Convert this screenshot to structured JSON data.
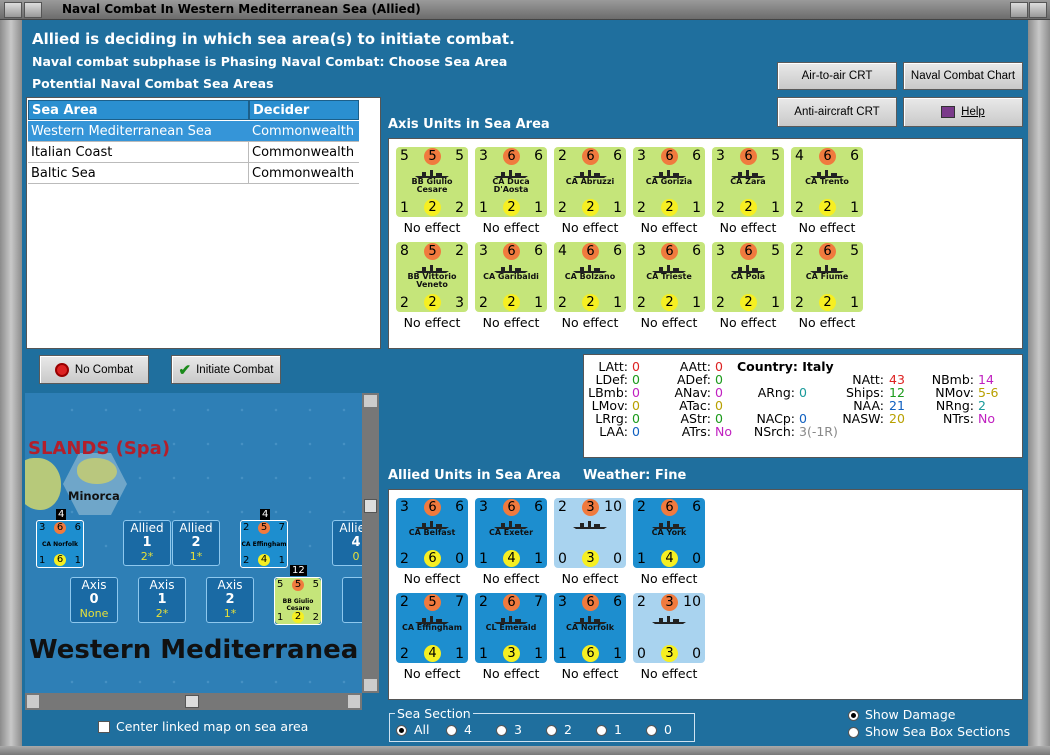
{
  "window": {
    "title": "Naval Combat In Western Mediterranean Sea (Allied)"
  },
  "header": {
    "line1": "Allied is deciding in which sea area(s) to initiate combat.",
    "line2": "Naval combat subphase is Phasing Naval Combat: Choose Sea Area",
    "line3": "Potential Naval Combat Sea Areas"
  },
  "buttons": {
    "air_to_air": "Air-to-air CRT",
    "naval_chart": "Naval Combat Chart",
    "anti_aircraft": "Anti-aircraft CRT",
    "help": "Help",
    "no_combat": "No Combat",
    "initiate": "Initiate Combat"
  },
  "table": {
    "headers": [
      "Sea Area",
      "Decider"
    ],
    "rows": [
      {
        "area": "Western Mediterranean Sea",
        "decider": "Commonwealth"
      },
      {
        "area": "Italian Coast",
        "decider": "Commonwealth"
      },
      {
        "area": "Baltic Sea",
        "decider": "Commonwealth"
      }
    ]
  },
  "axis": {
    "label": "Axis Units in Sea Area",
    "units": [
      {
        "tl": "5",
        "tm": "5",
        "tr": "5",
        "name": "BB Giulio Cesare",
        "bl": "1",
        "bm": "2",
        "br": "2",
        "effect": "No effect"
      },
      {
        "tl": "3",
        "tm": "6",
        "tr": "6",
        "name": "CA Duca D'Aosta",
        "bl": "1",
        "bm": "2",
        "br": "1",
        "effect": "No effect"
      },
      {
        "tl": "2",
        "tm": "6",
        "tr": "6",
        "name": "CA Abruzzi",
        "bl": "2",
        "bm": "2",
        "br": "1",
        "effect": "No effect"
      },
      {
        "tl": "3",
        "tm": "6",
        "tr": "6",
        "name": "CA Gorizia",
        "bl": "2",
        "bm": "2",
        "br": "1",
        "effect": "No effect"
      },
      {
        "tl": "3",
        "tm": "6",
        "tr": "5",
        "name": "CA Zara",
        "bl": "2",
        "bm": "2",
        "br": "1",
        "effect": "No effect"
      },
      {
        "tl": "4",
        "tm": "6",
        "tr": "6",
        "name": "CA Trento",
        "bl": "2",
        "bm": "2",
        "br": "1",
        "effect": "No effect"
      },
      {
        "tl": "8",
        "tm": "5",
        "tr": "2",
        "name": "BB Vittorio Veneto",
        "bl": "2",
        "bm": "2",
        "br": "3",
        "effect": "No effect"
      },
      {
        "tl": "3",
        "tm": "6",
        "tr": "6",
        "name": "CA Garibaldi",
        "bl": "2",
        "bm": "2",
        "br": "1",
        "effect": "No effect"
      },
      {
        "tl": "4",
        "tm": "6",
        "tr": "6",
        "name": "CA Bolzano",
        "bl": "2",
        "bm": "2",
        "br": "1",
        "effect": "No effect"
      },
      {
        "tl": "3",
        "tm": "6",
        "tr": "6",
        "name": "CA Trieste",
        "bl": "2",
        "bm": "2",
        "br": "1",
        "effect": "No effect"
      },
      {
        "tl": "3",
        "tm": "6",
        "tr": "5",
        "name": "CA Pola",
        "bl": "2",
        "bm": "2",
        "br": "1",
        "effect": "No effect"
      },
      {
        "tl": "2",
        "tm": "6",
        "tr": "5",
        "name": "CA Fiume",
        "bl": "2",
        "bm": "2",
        "br": "1",
        "effect": "No effect"
      }
    ]
  },
  "info": {
    "country_label": "Country: Italy",
    "col1": [
      [
        "LAtt:",
        "0"
      ],
      [
        "LDef:",
        "0"
      ],
      [
        "LBmb:",
        "0"
      ],
      [
        "LMov:",
        "0"
      ],
      [
        "LRrg:",
        "0"
      ],
      [
        "LAA:",
        "0"
      ]
    ],
    "col2": [
      [
        "AAtt:",
        "0"
      ],
      [
        "ADef:",
        "0"
      ],
      [
        "ANav:",
        "0"
      ],
      [
        "ATac:",
        "0"
      ],
      [
        "AStr:",
        "0"
      ],
      [
        "ATrs:",
        "No"
      ]
    ],
    "col3": [
      [
        "ARng:",
        "0"
      ],
      [
        "NACp:",
        "0"
      ],
      [
        "NSrch:",
        "3(-1R)"
      ]
    ],
    "col4": [
      [
        "NAtt:",
        "43"
      ],
      [
        "Ships:",
        "12"
      ],
      [
        "NAA:",
        "21"
      ],
      [
        "NASW:",
        "20"
      ]
    ],
    "col5": [
      [
        "NBmb:",
        "14"
      ],
      [
        "NMov:",
        "5-6"
      ],
      [
        "NRng:",
        "2"
      ],
      [
        "NTrs:",
        "No"
      ]
    ]
  },
  "allied": {
    "label": "Allied Units in Sea Area",
    "weather": "Weather:  Fine",
    "units": [
      {
        "tl": "3",
        "tm": "6",
        "tr": "6",
        "name": "CA Belfast",
        "bl": "2",
        "bm": "6",
        "br": "0",
        "effect": "No effect"
      },
      {
        "tl": "3",
        "tm": "6",
        "tr": "6",
        "name": "CA Exeter",
        "bl": "1",
        "bm": "4",
        "br": "1",
        "effect": "No effect"
      },
      {
        "tl": "2",
        "tm": "3",
        "tr": "10",
        "name": "",
        "bl": "0",
        "bm": "3",
        "br": "0",
        "effect": "No effect"
      },
      {
        "tl": "2",
        "tm": "6",
        "tr": "6",
        "name": "CA York",
        "bl": "1",
        "bm": "4",
        "br": "0",
        "effect": "No effect"
      },
      {
        "tl": "2",
        "tm": "5",
        "tr": "7",
        "name": "CA Effingham",
        "bl": "2",
        "bm": "4",
        "br": "1",
        "effect": "No effect"
      },
      {
        "tl": "2",
        "tm": "6",
        "tr": "7",
        "name": "CL Emerald",
        "bl": "1",
        "bm": "3",
        "br": "1",
        "effect": "No effect"
      },
      {
        "tl": "3",
        "tm": "6",
        "tr": "6",
        "name": "CA Norfolk",
        "bl": "1",
        "bm": "6",
        "br": "1",
        "effect": "No effect"
      },
      {
        "tl": "2",
        "tm": "3",
        "tr": "10",
        "name": "",
        "bl": "0",
        "bm": "3",
        "br": "0",
        "effect": "No effect"
      }
    ]
  },
  "map": {
    "islands": "SLANDS (Spa)",
    "minorca": "Minorca",
    "sea_name": "Western Mediterranea",
    "allied_boxes": [
      {
        "t": "Allied",
        "n": "1",
        "s": "2*"
      },
      {
        "t": "Allied",
        "n": "2",
        "s": "1*"
      },
      {
        "t": "Allied",
        "n": "4",
        "s": "0"
      }
    ],
    "axis_boxes": [
      {
        "t": "Axis",
        "n": "0",
        "s": "None"
      },
      {
        "t": "Axis",
        "n": "1",
        "s": "2*"
      },
      {
        "t": "Axis",
        "n": "2",
        "s": "1*"
      }
    ],
    "norfolk": {
      "stack": "4",
      "tl": "3",
      "tm": "6",
      "tr": "6",
      "name": "CA Norfolk",
      "bl": "1",
      "bm": "6",
      "br": "1"
    },
    "effingham": {
      "stack": "4",
      "tl": "2",
      "tm": "5",
      "tr": "7",
      "name": "CA Effingham",
      "bl": "2",
      "bm": "4",
      "br": "1"
    },
    "cesare": {
      "stack": "12",
      "tl": "5",
      "tm": "5",
      "tr": "5",
      "name": "BB Giulio Cesare",
      "bl": "1",
      "bm": "2",
      "br": "2"
    }
  },
  "center_link": "Center linked map on sea area",
  "sea_section": {
    "label": "Sea Section",
    "options": [
      "All",
      "4",
      "3",
      "2",
      "1",
      "0"
    ]
  },
  "show": {
    "damage": "Show Damage",
    "sections": "Show Sea Box Sections"
  },
  "colors": {
    "background": "#1f6f9e",
    "axis_counter": "#c5e57a",
    "allied_counter": "#1d8ecf"
  }
}
